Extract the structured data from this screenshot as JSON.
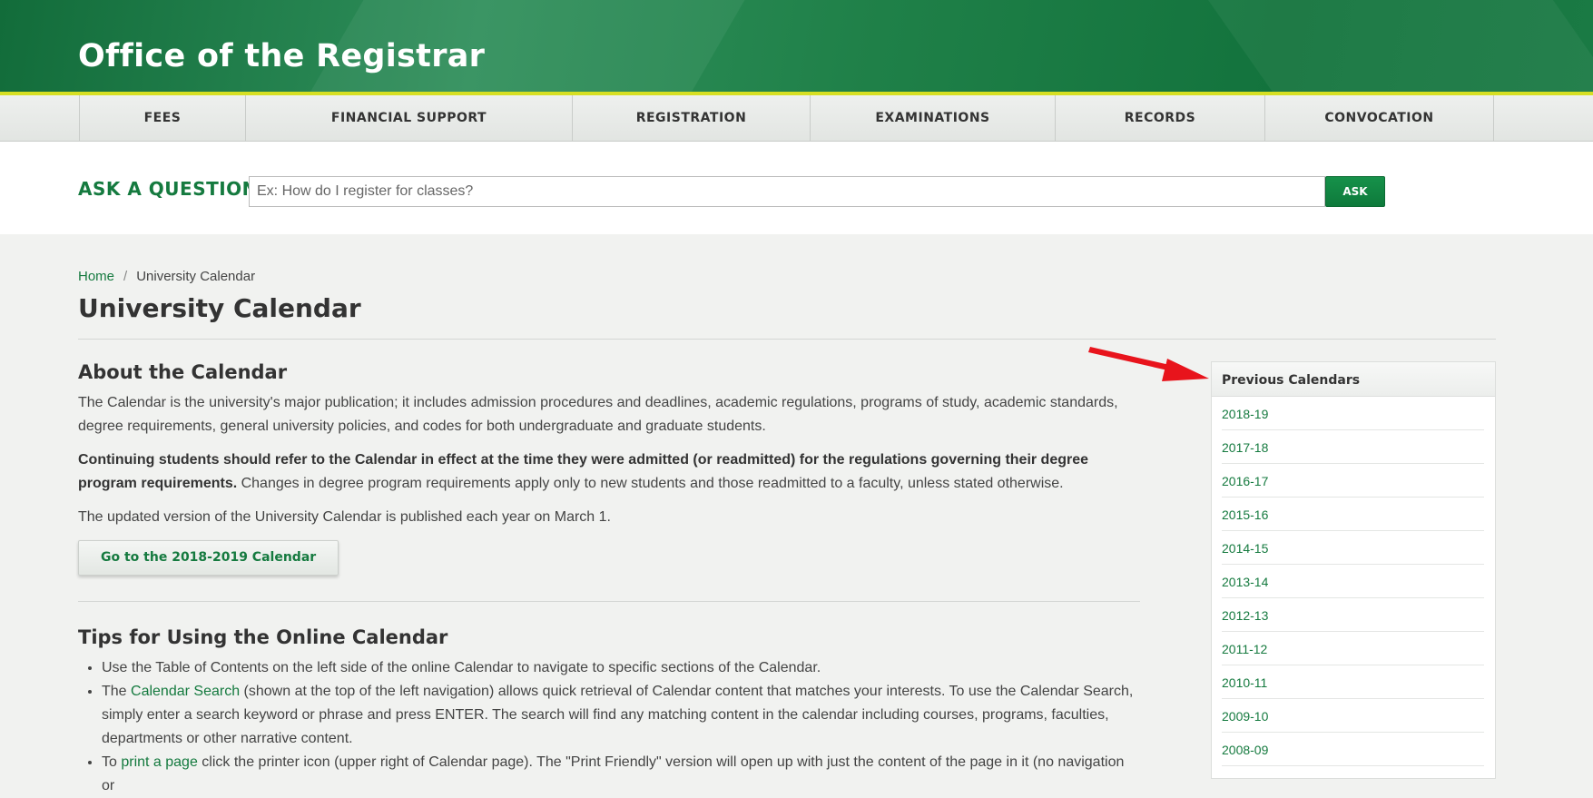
{
  "header": {
    "site_title": "Office of the Registrar"
  },
  "nav": {
    "items": [
      {
        "label": "FEES"
      },
      {
        "label": "FINANCIAL SUPPORT"
      },
      {
        "label": "REGISTRATION"
      },
      {
        "label": "EXAMINATIONS"
      },
      {
        "label": "RECORDS"
      },
      {
        "label": "CONVOCATION"
      }
    ]
  },
  "ask": {
    "label": "ASK A QUESTION",
    "placeholder": "Ex: How do I register for classes?",
    "button": "ASK"
  },
  "breadcrumb": {
    "home": "Home",
    "separator": "/",
    "current": "University Calendar"
  },
  "page_title": "University Calendar",
  "about": {
    "heading": "About the Calendar",
    "p1": "The Calendar is the university's major publication; it includes admission procedures and deadlines, academic regulations, programs of study, academic standards, degree requirements, general university policies, and codes for both undergraduate and graduate students.",
    "p2_bold": "Continuing students should refer to the Calendar in effect at the time they were admitted (or readmitted) for the regulations governing their degree program requirements.",
    "p2_rest": " Changes in degree program requirements apply only to new students and those readmitted to a faculty, unless stated otherwise.",
    "p3": "The updated version of the University Calendar is published each year on March 1.",
    "button": "Go to the 2018-2019 Calendar"
  },
  "tips": {
    "heading": "Tips for Using the Online Calendar",
    "tip1": "Use the Table of Contents on the left side of the online Calendar to navigate to specific sections of the Calendar.",
    "tip2_pre": "The ",
    "tip2_link": "Calendar Search",
    "tip2_post": " (shown at the top of the left navigation) allows quick retrieval of Calendar content that matches your interests. To use the Calendar Search, simply enter a search keyword or phrase and press ENTER. The search will find any matching content in the calendar including courses, programs, faculties, departments or other narrative content.",
    "tip3_pre": "To ",
    "tip3_link": "print a page",
    "tip3_post": " click the printer icon (upper right of Calendar page). The \"Print Friendly\" version will open up with just the content of the page in it (no navigation or"
  },
  "sidebar": {
    "title": "Previous Calendars",
    "items": [
      "2018-19",
      "2017-18",
      "2016-17",
      "2015-16",
      "2014-15",
      "2013-14",
      "2012-13",
      "2011-12",
      "2010-11",
      "2009-10",
      "2008-09"
    ]
  },
  "colors": {
    "brand_green": "#157a3f",
    "accent_yellow": "#d7df23",
    "arrow_red": "#e8141c"
  }
}
